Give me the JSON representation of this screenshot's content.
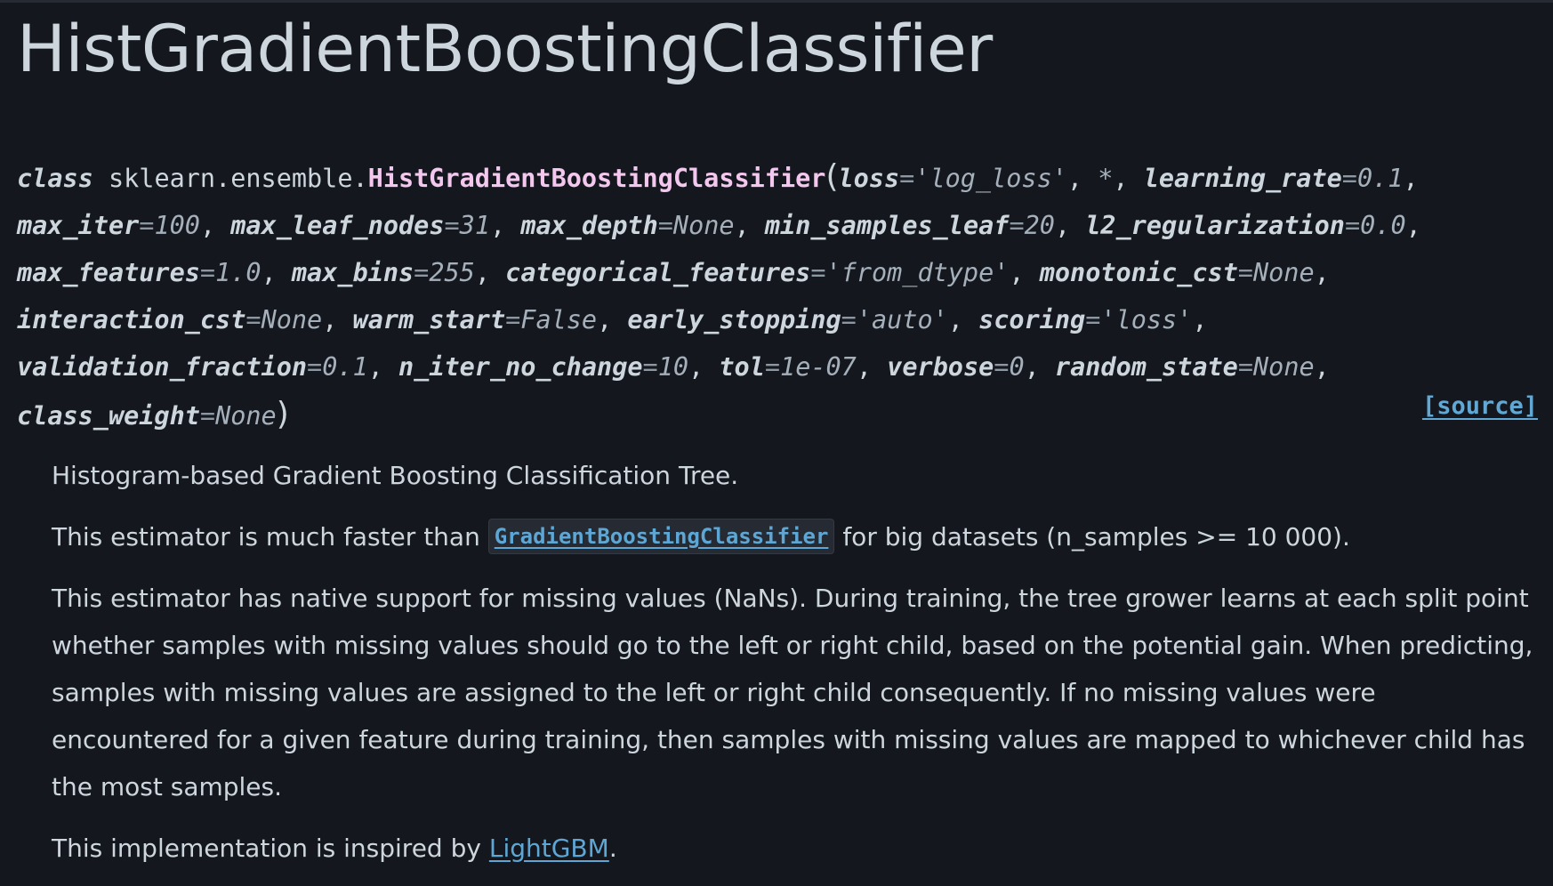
{
  "page_title": "HistGradientBoostingClassifier",
  "signature": {
    "keyword": "class",
    "module": "sklearn.ensemble.",
    "class_name": "HistGradientBoostingClassifier",
    "open_paren": "(",
    "close_paren": ")",
    "star": "*",
    "params": [
      {
        "name": "loss",
        "value": "'log_loss'"
      },
      {
        "name": "learning_rate",
        "value": "0.1"
      },
      {
        "name": "max_iter",
        "value": "100"
      },
      {
        "name": "max_leaf_nodes",
        "value": "31"
      },
      {
        "name": "max_depth",
        "value": "None"
      },
      {
        "name": "min_samples_leaf",
        "value": "20"
      },
      {
        "name": "l2_regularization",
        "value": "0.0"
      },
      {
        "name": "max_features",
        "value": "1.0"
      },
      {
        "name": "max_bins",
        "value": "255"
      },
      {
        "name": "categorical_features",
        "value": "'from_dtype'"
      },
      {
        "name": "monotonic_cst",
        "value": "None"
      },
      {
        "name": "interaction_cst",
        "value": "None"
      },
      {
        "name": "warm_start",
        "value": "False"
      },
      {
        "name": "early_stopping",
        "value": "'auto'"
      },
      {
        "name": "scoring",
        "value": "'loss'"
      },
      {
        "name": "validation_fraction",
        "value": "0.1"
      },
      {
        "name": "n_iter_no_change",
        "value": "10"
      },
      {
        "name": "tol",
        "value": "1e-07"
      },
      {
        "name": "verbose",
        "value": "0"
      },
      {
        "name": "random_state",
        "value": "None"
      },
      {
        "name": "class_weight",
        "value": "None"
      }
    ],
    "source_label": "[source]"
  },
  "description": {
    "summary": "Histogram-based Gradient Boosting Classification Tree.",
    "speed_pre": "This estimator is much faster than",
    "speed_code": "GradientBoostingClassifier",
    "speed_post": "for big datasets (n_samples >= 10 000).",
    "missing_values": "This estimator has native support for missing values (NaNs). During training, the tree grower learns at each split point whether samples with missing values should go to the left or right child, based on the potential gain. When predicting, samples with missing values are assigned to the left or right child consequently. If no missing values were encountered for a given feature during training, then samples with missing values are mapped to whichever child has the most samples.",
    "inspired_pre": "This implementation is inspired by",
    "inspired_link": "LightGBM",
    "inspired_post": "."
  },
  "colors": {
    "background": "#14181e",
    "text": "#ced6dd",
    "class_name": "#f3c7ee",
    "link": "#5ea7d5"
  }
}
